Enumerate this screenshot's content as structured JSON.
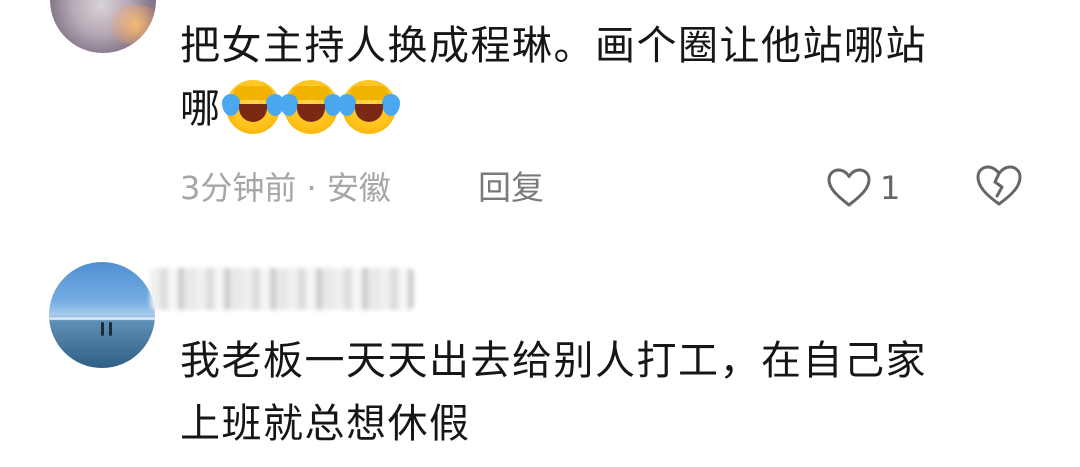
{
  "comments": [
    {
      "text_line1": "把女主持人换成程琳。画个圈让他站哪站",
      "text_line2": "哪",
      "emojis": [
        "facepalm-laugh-emoji",
        "facepalm-laugh-emoji",
        "facepalm-laugh-emoji"
      ],
      "meta": "3分钟前 · 安徽",
      "reply_label": "回复",
      "like_count": "1",
      "icons": [
        "heart-outline-icon",
        "broken-heart-icon"
      ]
    },
    {
      "username": "",
      "text_line1": "我老板一天天出去给别人打工，在自己家",
      "text_line2": "上班就总想休假"
    }
  ],
  "colors": {
    "text": "#161616",
    "meta": "#a6a6a6",
    "icon": "#666666"
  }
}
